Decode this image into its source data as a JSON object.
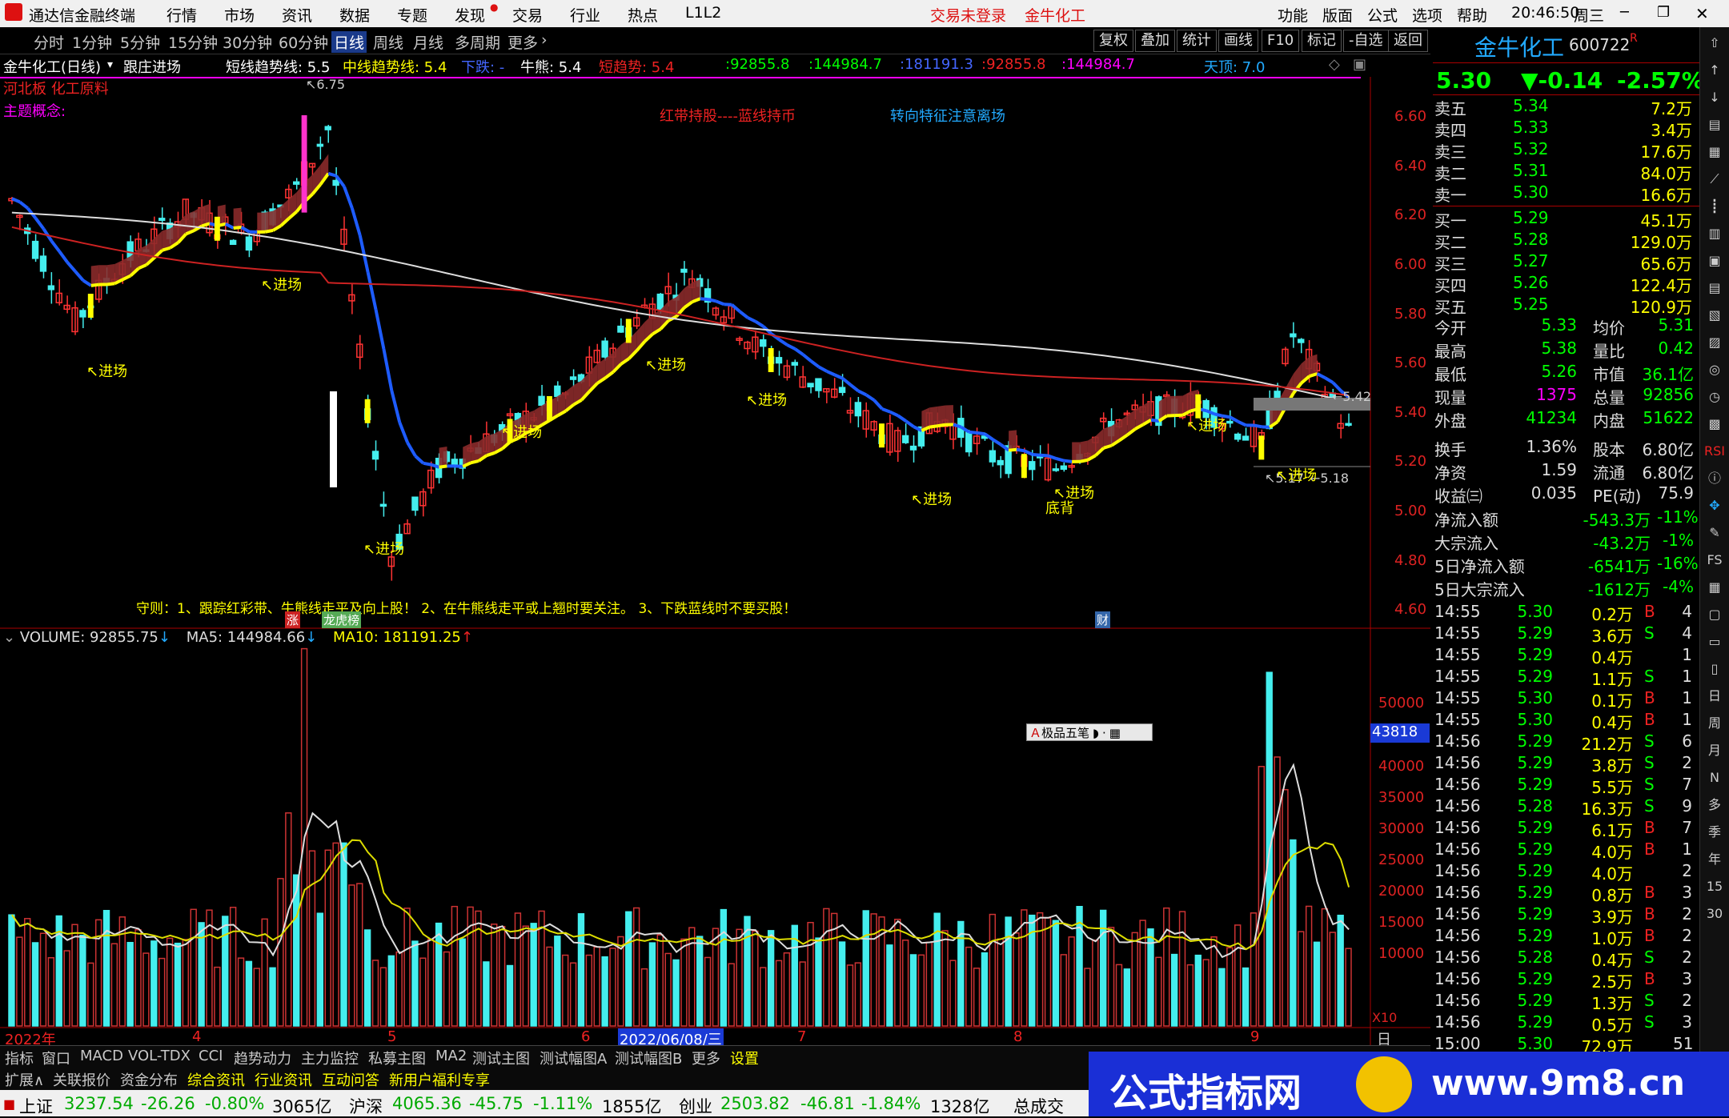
{
  "titlebar": {
    "app_title": "通达信金融终端",
    "menus": [
      "行情",
      "市场",
      "资讯",
      "数据",
      "专题",
      "发现",
      "交易",
      "行业",
      "热点",
      "L1L2"
    ],
    "login_status": "交易未登录",
    "stock_name": "金牛化工",
    "right_menus": [
      "功能",
      "版面",
      "公式",
      "选项",
      "帮助"
    ],
    "clock": "20:46:50",
    "weekday": "周三"
  },
  "periodbar": {
    "stock_label": "金牛化工(日线)",
    "formula": "跟庄进场",
    "periods": [
      "分时",
      "1分钟",
      "5分钟",
      "15分钟",
      "30分钟",
      "60分钟",
      "日线",
      "周线",
      "月线",
      "多周期",
      "更多"
    ],
    "selected": "日线",
    "tools": [
      "复权",
      "叠加",
      "统计",
      "画线",
      "F10",
      "标记",
      "-自选",
      "返回"
    ]
  },
  "indicators": {
    "short_trend": "短线趋势线: 5.5",
    "mid_trend": "中线趋势线: 5.4",
    "down": "下跌: -",
    "bull_bear": "牛熊: 5.4",
    "short_potential": "短趋势: 5.4",
    "v1": ":92855.8",
    "v2": ":144984.7",
    "v3": ":181191.3",
    "v4": ":92855.8",
    "v5": ":144984.7",
    "top": "天顶: 7.0"
  },
  "chart_labels": {
    "sector": "河北板  化工原料",
    "concept": "主题概念:",
    "note1": "红带持股----蓝线持币",
    "note2": "转向特征注意离场",
    "rules": "守则：1、跟踪红彩带、牛熊线走平及向上股！ 2、在牛熊线走平或上翘时要关注。 3、下跌蓝线时不要买股！",
    "entry": "进场",
    "bottom": "底背",
    "high_mark": "6.75",
    "low_mark1": "5.17",
    "low_mark2": "5.18",
    "price_mark": "5.42",
    "zhang": "涨",
    "longhu": "龙虎榜",
    "cai": "财"
  },
  "price_axis": [
    "6.60",
    "6.40",
    "6.20",
    "6.00",
    "5.80",
    "5.60",
    "5.40",
    "5.20",
    "5.00",
    "4.80",
    "4.60"
  ],
  "volume_bar": {
    "volume": "VOLUME: 92855.75",
    "ma5": "MA5: 144984.66",
    "ma10": "MA10: 181191.25"
  },
  "volume_axis": [
    "50000",
    "40000",
    "35000",
    "30000",
    "25000",
    "20000",
    "15000",
    "10000"
  ],
  "vol_current": "43818",
  "vol_unit": "X10",
  "tooltip_widget": "极品五笔",
  "date_axis": {
    "start": "2022年",
    "m4": "4",
    "m5": "5",
    "m6": "6",
    "cursor": "2022/06/08/三",
    "m7": "7",
    "m8": "8",
    "m9": "9",
    "period": "日线"
  },
  "quote": {
    "name": "金牛化工",
    "code": "600722",
    "price": "5.30",
    "change": "▼-0.14",
    "pct": "-2.57%",
    "asks": [
      {
        "label": "卖五",
        "price": "5.34",
        "vol": "7.2万"
      },
      {
        "label": "卖四",
        "price": "5.33",
        "vol": "3.4万"
      },
      {
        "label": "卖三",
        "price": "5.32",
        "vol": "17.6万"
      },
      {
        "label": "卖二",
        "price": "5.31",
        "vol": "84.0万"
      },
      {
        "label": "卖一",
        "price": "5.30",
        "vol": "16.6万"
      }
    ],
    "bids": [
      {
        "label": "买一",
        "price": "5.29",
        "vol": "45.1万"
      },
      {
        "label": "买二",
        "price": "5.28",
        "vol": "129.0万"
      },
      {
        "label": "买三",
        "price": "5.27",
        "vol": "65.6万"
      },
      {
        "label": "买四",
        "price": "5.26",
        "vol": "122.4万"
      },
      {
        "label": "买五",
        "price": "5.25",
        "vol": "120.9万"
      }
    ],
    "stats": [
      {
        "l1": "今开",
        "v1": "5.33",
        "l2": "均价",
        "v2": "5.31"
      },
      {
        "l1": "最高",
        "v1": "5.38",
        "l2": "量比",
        "v2": "0.42"
      },
      {
        "l1": "最低",
        "v1": "5.26",
        "l2": "市值",
        "v2": "36.1亿"
      },
      {
        "l1": "现量",
        "v1": "1375",
        "l2": "总量",
        "v2": "92856"
      },
      {
        "l1": "外盘",
        "v1": "41234",
        "l2": "内盘",
        "v2": "51622"
      }
    ],
    "stats2": [
      {
        "l1": "换手",
        "v1": "1.36%",
        "l2": "股本",
        "v2": "6.80亿"
      },
      {
        "l1": "净资",
        "v1": "1.59",
        "l2": "流通",
        "v2": "6.80亿"
      },
      {
        "l1": "收益㈢",
        "v1": "0.035",
        "l2": "PE(动)",
        "v2": "75.9"
      }
    ],
    "flows": [
      {
        "l": "净流入额",
        "v": "-543.3万",
        "p": "-11%"
      },
      {
        "l": "大宗流入",
        "v": "-43.2万",
        "p": "-1%"
      },
      {
        "l": "5日净流入额",
        "v": "-6541万",
        "p": "-16%"
      },
      {
        "l": "5日大宗流入",
        "v": "-1612万",
        "p": "-4%"
      }
    ],
    "ticks": [
      {
        "t": "14:55",
        "p": "5.30",
        "v": "0.2万",
        "s": "B",
        "n": "4"
      },
      {
        "t": "14:55",
        "p": "5.29",
        "v": "3.6万",
        "s": "S",
        "n": "4"
      },
      {
        "t": "14:55",
        "p": "5.29",
        "v": "0.4万",
        "s": "",
        "n": "1"
      },
      {
        "t": "14:55",
        "p": "5.29",
        "v": "1.1万",
        "s": "S",
        "n": "1"
      },
      {
        "t": "14:55",
        "p": "5.30",
        "v": "0.1万",
        "s": "B",
        "n": "1"
      },
      {
        "t": "14:55",
        "p": "5.30",
        "v": "0.4万",
        "s": "B",
        "n": "1"
      },
      {
        "t": "14:56",
        "p": "5.29",
        "v": "21.2万",
        "s": "S",
        "n": "6"
      },
      {
        "t": "14:56",
        "p": "5.29",
        "v": "3.8万",
        "s": "S",
        "n": "2"
      },
      {
        "t": "14:56",
        "p": "5.29",
        "v": "5.5万",
        "s": "S",
        "n": "7"
      },
      {
        "t": "14:56",
        "p": "5.28",
        "v": "16.3万",
        "s": "S",
        "n": "9"
      },
      {
        "t": "14:56",
        "p": "5.29",
        "v": "6.1万",
        "s": "B",
        "n": "7"
      },
      {
        "t": "14:56",
        "p": "5.29",
        "v": "4.0万",
        "s": "B",
        "n": "1"
      },
      {
        "t": "14:56",
        "p": "5.29",
        "v": "4.0万",
        "s": "",
        "n": "2"
      },
      {
        "t": "14:56",
        "p": "5.29",
        "v": "0.8万",
        "s": "B",
        "n": "3"
      },
      {
        "t": "14:56",
        "p": "5.29",
        "v": "3.9万",
        "s": "B",
        "n": "2"
      },
      {
        "t": "14:56",
        "p": "5.29",
        "v": "1.0万",
        "s": "B",
        "n": "2"
      },
      {
        "t": "14:56",
        "p": "5.28",
        "v": "0.4万",
        "s": "S",
        "n": "2"
      },
      {
        "t": "14:56",
        "p": "5.29",
        "v": "2.5万",
        "s": "B",
        "n": "3"
      },
      {
        "t": "14:56",
        "p": "5.29",
        "v": "1.3万",
        "s": "S",
        "n": "2"
      },
      {
        "t": "14:56",
        "p": "5.29",
        "v": "0.5万",
        "s": "S",
        "n": "3"
      },
      {
        "t": "15:00",
        "p": "5.30",
        "v": "72.9万",
        "s": "",
        "n": "51"
      }
    ]
  },
  "sidebar": [
    "日",
    "周",
    "月",
    "N",
    "多",
    "季",
    "年",
    "15",
    "30"
  ],
  "bottom_tabs": [
    "指标",
    "窗口",
    "MACD",
    "VOL-TDX",
    "CCI",
    "趋势动力",
    "主力监控",
    "私募主图",
    "MA2",
    "测试主图",
    "测试幅图A",
    "测试幅图B",
    "更多",
    "设置"
  ],
  "bottom_tabs2": [
    "扩展∧",
    "关联报价",
    "资金分布",
    "综合资讯",
    "行业资讯",
    "互动问答",
    "新用户福利专享"
  ],
  "statusbar": {
    "sh_label": "上证",
    "sh": "3237.54",
    "sh_ch": "-26.26",
    "sh_pct": "-0.80%",
    "sh_amt": "3065亿",
    "hs_label": "沪深",
    "hs": "4065.36",
    "hs_ch": "-45.75",
    "hs_pct": "-1.11%",
    "hs_amt": "1855亿",
    "cy_label": "创业",
    "cy": "2503.82",
    "cy_ch": "-46.81",
    "cy_pct": "-1.84%",
    "cy_amt": "1328亿",
    "total_label": "总成交"
  },
  "watermark": {
    "text": "公式指标网",
    "url": "www.9m8.cn"
  },
  "chart_data": {
    "type": "candlestick",
    "price_range": [
      4.6,
      6.75
    ],
    "ma_white_start": 6.2,
    "ma_white_end": 5.42,
    "ma_red_start": 6.1,
    "ma_red_end": 5.4,
    "volume_range": [
      0,
      55000
    ],
    "volume_last": 43818
  }
}
